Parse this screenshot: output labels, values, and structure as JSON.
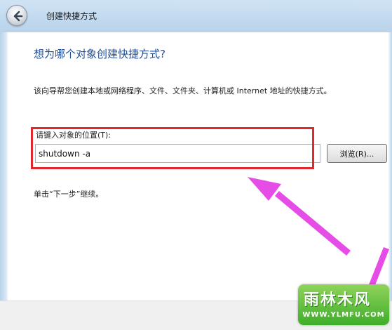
{
  "window": {
    "title": "创建快捷方式"
  },
  "main": {
    "heading": "想为哪个对象创建快捷方式?",
    "description": "该向导帮您创建本地或网络程序、文件、文件夹、计算机或 Internet 地址的快捷方式。",
    "location_label": "请键入对象的位置(T):",
    "location_value": "shutdown -a",
    "browse_label": "浏览(R)...",
    "hint": "单击“下一步”继续。"
  },
  "watermark": {
    "logo_text": "雨林木风",
    "url": "WWW.YLMFU.COM"
  },
  "colors": {
    "heading": "#1f4e98",
    "highlight": "#e0282d",
    "arrow": "#e64ce6"
  }
}
